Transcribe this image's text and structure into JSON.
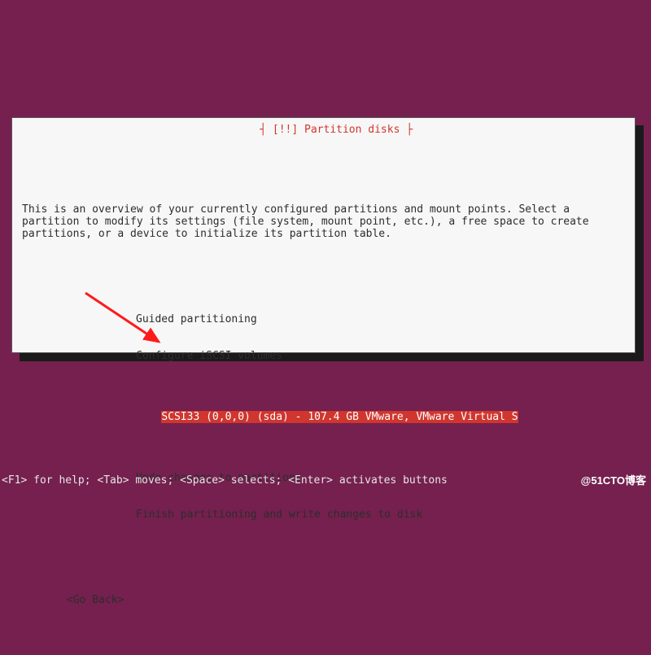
{
  "dialog": {
    "title_prefix": "┤ ",
    "title_bang": "[!!]",
    "title_text": " Partition disks ",
    "title_suffix": "├",
    "intro_l1": "This is an overview of your currently configured partitions and mount points. Select a",
    "intro_l2": "partition to modify its settings (file system, mount point, etc.), a free space to create",
    "intro_l3": "partitions, or a device to initialize its partition table.",
    "items": {
      "guided": "Guided partitioning",
      "iscsi": "Configure iSCSI volumes",
      "disk": "SCSI33 (0,0,0) (sda) - 107.4 GB VMware, VMware Virtual S",
      "undo": "Undo changes to partitions",
      "finish": "Finish partitioning and write changes to disk"
    },
    "go_back": "<Go Back>"
  },
  "helpbar": "<F1> for help; <Tab> moves; <Space> selects; <Enter> activates buttons",
  "watermark": "@51CTO博客"
}
